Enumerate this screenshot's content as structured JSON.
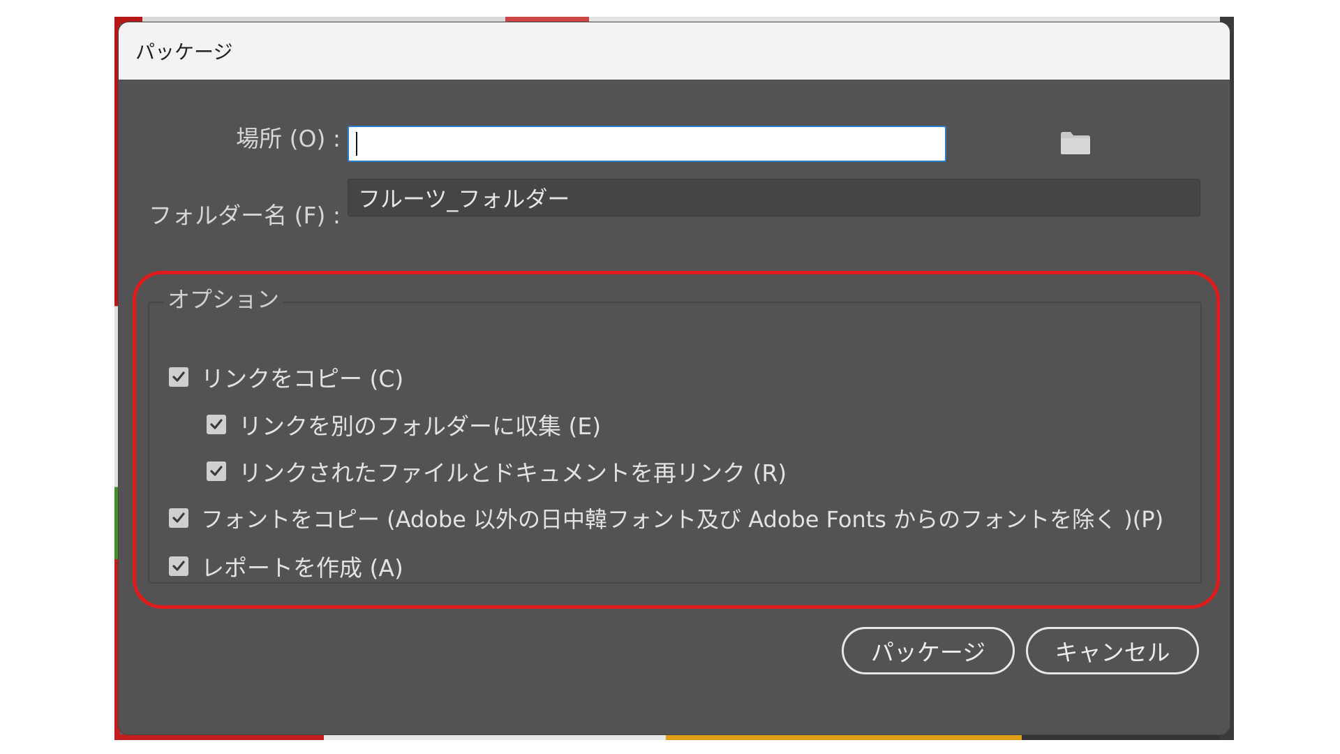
{
  "dialog": {
    "title": "パッケージ"
  },
  "location": {
    "label": "場所 (O) :",
    "value": "",
    "browse_icon": "folder-icon"
  },
  "folder_name": {
    "label": "フォルダー名 (F) :",
    "value": "フルーツ_フォルダー"
  },
  "options": {
    "legend": "オプション",
    "items": [
      {
        "label": "リンクをコピー (C)",
        "checked": true
      },
      {
        "label": "リンクを別のフォルダーに収集 (E)",
        "checked": true
      },
      {
        "label": "リンクされたファイルとドキュメントを再リンク (R)",
        "checked": true
      },
      {
        "label": "フォントをコピー (Adobe 以外の日中韓フォント及び Adobe Fonts からのフォントを除く )(P)",
        "checked": true
      },
      {
        "label": "レポートを作成 (A)",
        "checked": true
      }
    ]
  },
  "buttons": {
    "package": "パッケージ",
    "cancel": "キャンセル"
  },
  "colors": {
    "dialog_bg": "#535353",
    "highlight": "#e11b1b",
    "focus_border": "#2a7fd4"
  }
}
